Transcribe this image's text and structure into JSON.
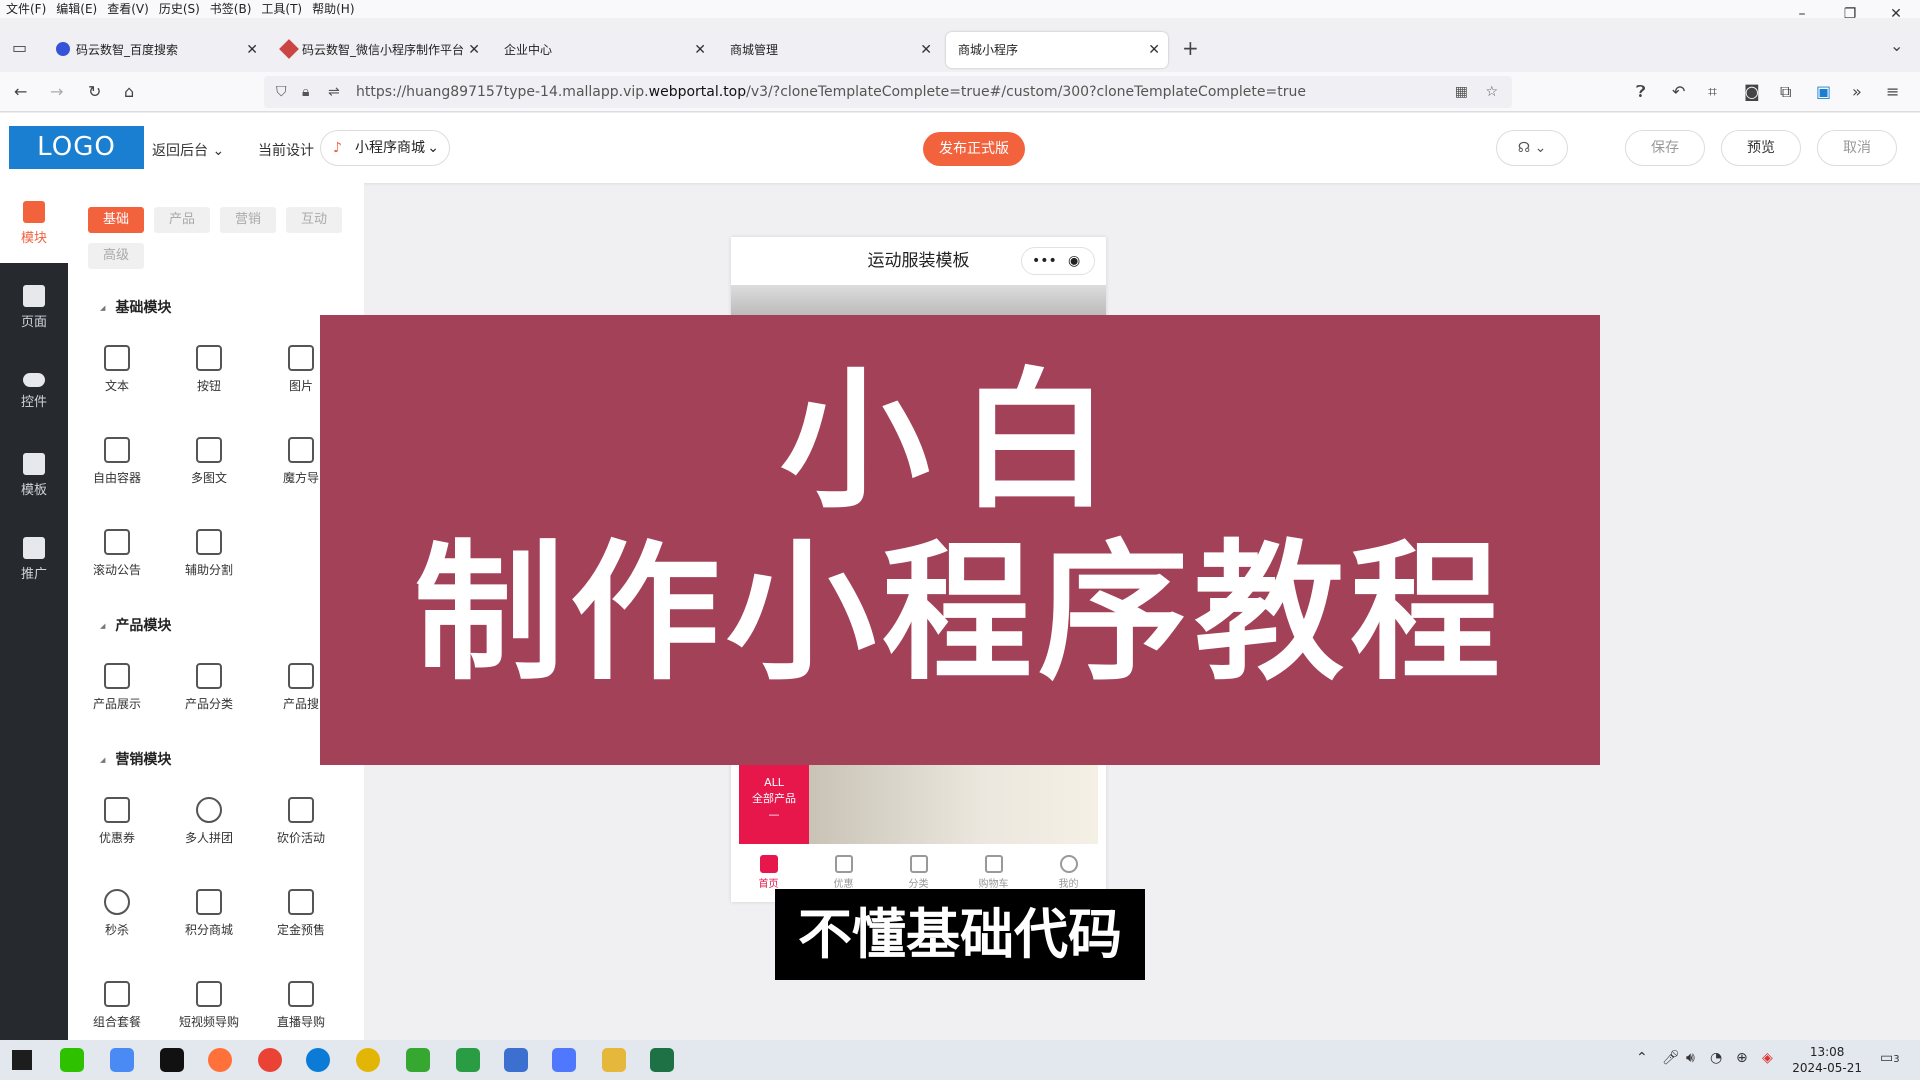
{
  "menubar": [
    "文件(F)",
    "编辑(E)",
    "查看(V)",
    "历史(S)",
    "书签(B)",
    "工具(T)",
    "帮助(H)"
  ],
  "window_controls": {
    "minimize": "–",
    "restore": "❐",
    "close": "✕"
  },
  "tabs": [
    {
      "label": "码云数智_百度搜索",
      "color": "#3553d9"
    },
    {
      "label": "码云数智_微信小程序制作平台",
      "color": "#cc4545"
    },
    {
      "label": "企业中心",
      "color": "#888888"
    },
    {
      "label": "商城管理",
      "color": "#888888"
    },
    {
      "label": "商城小程序",
      "color": "#888888"
    }
  ],
  "address": {
    "prefix": "https://huang897157type-14.mallapp.vip.",
    "domain": "webportal.top",
    "suffix": "/v3/?cloneTemplateComplete=true#/custom/300?cloneTemplateComplete=true"
  },
  "header": {
    "logo": "LOGO",
    "back": "返回后台",
    "current_design_label": "当前设计",
    "current_design_value": "小程序商城",
    "publish": "发布正式版",
    "save": "保存",
    "preview": "预览",
    "cancel": "取消"
  },
  "rail": [
    {
      "label": "模块",
      "icon": "module-icon"
    },
    {
      "label": "页面",
      "icon": "page-icon"
    },
    {
      "label": "控件",
      "icon": "toggle-icon"
    },
    {
      "label": "模板",
      "icon": "template-icon"
    },
    {
      "label": "推广",
      "icon": "megaphone-icon"
    }
  ],
  "panel": {
    "tabs": [
      "基础",
      "产品",
      "营销",
      "互动",
      "高级"
    ],
    "sections": [
      {
        "title": "基础模块",
        "items": [
          "文本",
          "按钮",
          "图片",
          "自由容器",
          "多图文",
          "魔方导",
          "滚动公告",
          "辅助分割"
        ]
      },
      {
        "title": "产品模块",
        "items": [
          "产品展示",
          "产品分类",
          "产品搜"
        ]
      },
      {
        "title": "营销模块",
        "items": [
          "优惠券",
          "多人拼团",
          "砍价活动",
          "秒杀",
          "积分商城",
          "定金预售",
          "组合套餐",
          "短视频导购",
          "直播导购"
        ]
      }
    ]
  },
  "phone": {
    "title": "运动服装模板",
    "capsule_dots": "•••",
    "capsule_target": "◉",
    "all_en": "ALL",
    "all_cn": "全部产品",
    "all_dash": "—",
    "tabbar": [
      "首页",
      "优惠",
      "分类",
      "购物车",
      "我的"
    ]
  },
  "overlay": {
    "line1": "小白",
    "line2": "制作小程序教程",
    "caption": "不懂基础代码"
  },
  "taskbar": {
    "time": "13:08",
    "date": "2024-05-21",
    "notifications": "3"
  },
  "colors": {
    "accent": "#f2623d",
    "banner": "#a34158",
    "brand_blue": "#1a7fd0"
  }
}
